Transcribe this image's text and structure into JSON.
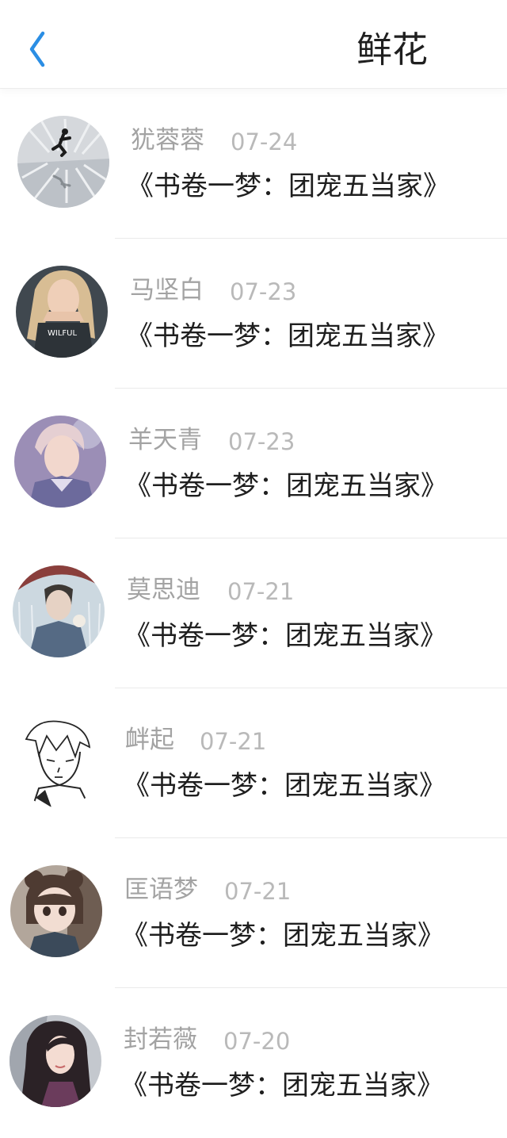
{
  "header": {
    "back_icon": "chevron-left-icon",
    "title": "鲜花",
    "accent_color": "#2b8ee4"
  },
  "list": {
    "items": [
      {
        "name": "犹蓉蓉",
        "date": "07-24",
        "book": "《书卷一梦：团宠五当家》",
        "avatar_icon": "avatar-runner-icon"
      },
      {
        "name": "马坚白",
        "date": "07-23",
        "book": "《书卷一梦：团宠五当家》",
        "avatar_icon": "avatar-girl-icon"
      },
      {
        "name": "羊天青",
        "date": "07-23",
        "book": "《书卷一梦：团宠五当家》",
        "avatar_icon": "avatar-boy-icon"
      },
      {
        "name": "莫思迪",
        "date": "07-21",
        "book": "《书卷一梦：团宠五当家》",
        "avatar_icon": "avatar-umbrella-icon"
      },
      {
        "name": "衅起",
        "date": "07-21",
        "book": "《书卷一梦：团宠五当家》",
        "avatar_icon": "avatar-sketch-icon"
      },
      {
        "name": "匡语梦",
        "date": "07-21",
        "book": "《书卷一梦：团宠五当家》",
        "avatar_icon": "avatar-doll-icon"
      },
      {
        "name": "封若薇",
        "date": "07-20",
        "book": "《书卷一梦：团宠五当家》",
        "avatar_icon": "avatar-longhair-icon"
      }
    ]
  }
}
